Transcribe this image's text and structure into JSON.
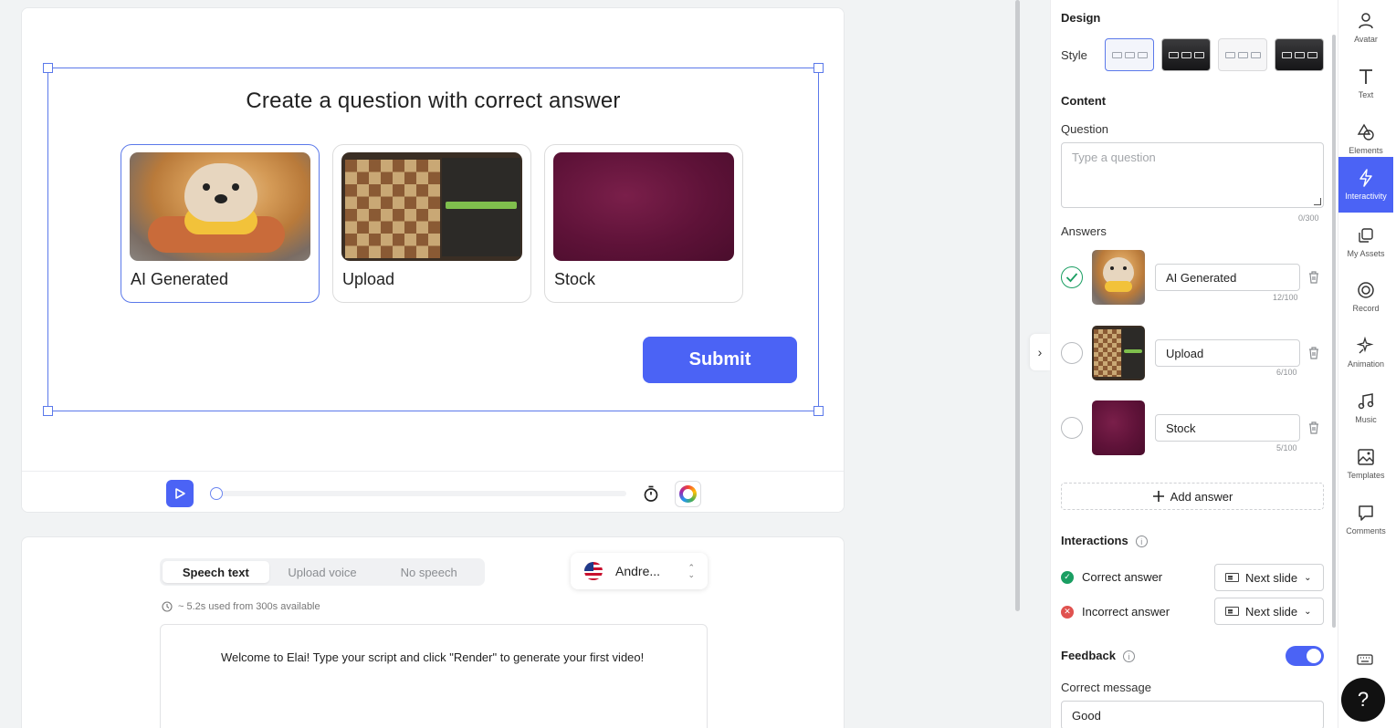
{
  "slide": {
    "question_title": "Create a question with correct answer",
    "answers": [
      {
        "label": "AI Generated",
        "selected": true
      },
      {
        "label": "Upload",
        "selected": false
      },
      {
        "label": "Stock",
        "selected": false
      }
    ],
    "submit_label": "Submit"
  },
  "player": {
    "progress_fraction": 0.0
  },
  "speech": {
    "tabs": [
      "Speech text",
      "Upload voice",
      "No speech"
    ],
    "active_tab": "Speech text",
    "voice_name": "Andre...",
    "usage_text": "~ 5.2s used from 300s available",
    "script_text": "Welcome to Elai! Type your script and click \"Render\" to generate your first video!"
  },
  "panel": {
    "design_title": "Design",
    "style_label": "Style",
    "content_title": "Content",
    "question_label": "Question",
    "question_placeholder": "Type a question",
    "question_counter": "0/300",
    "answers_label": "Answers",
    "answer_rows": [
      {
        "value": "AI Generated",
        "counter": "12/100",
        "correct": true
      },
      {
        "value": "Upload",
        "counter": "6/100",
        "correct": false
      },
      {
        "value": "Stock",
        "counter": "5/100",
        "correct": false
      }
    ],
    "add_answer_label": "Add answer",
    "interactions_title": "Interactions",
    "correct_answer_label": "Correct answer",
    "incorrect_answer_label": "Incorrect answer",
    "correct_action": "Next slide",
    "incorrect_action": "Next slide",
    "feedback_title": "Feedback",
    "feedback_enabled": true,
    "correct_message_label": "Correct message",
    "correct_message_value": "Good"
  },
  "rail": {
    "items": [
      {
        "label": "Avatar",
        "icon": "avatar-icon"
      },
      {
        "label": "Text",
        "icon": "text-icon"
      },
      {
        "label": "Elements",
        "icon": "elements-icon"
      },
      {
        "label": "Interactivity",
        "icon": "interactivity-icon",
        "active": true
      },
      {
        "label": "My Assets",
        "icon": "my-assets-icon"
      },
      {
        "label": "Record",
        "icon": "record-icon"
      },
      {
        "label": "Animation",
        "icon": "animation-icon"
      },
      {
        "label": "Music",
        "icon": "music-icon"
      },
      {
        "label": "Templates",
        "icon": "templates-icon"
      },
      {
        "label": "Comments",
        "icon": "comments-icon"
      }
    ],
    "help_label": "?"
  },
  "colors": {
    "accent": "#4b63f5",
    "selection": "#5b79ea",
    "correct": "#1a9e62",
    "incorrect": "#e0524f"
  }
}
